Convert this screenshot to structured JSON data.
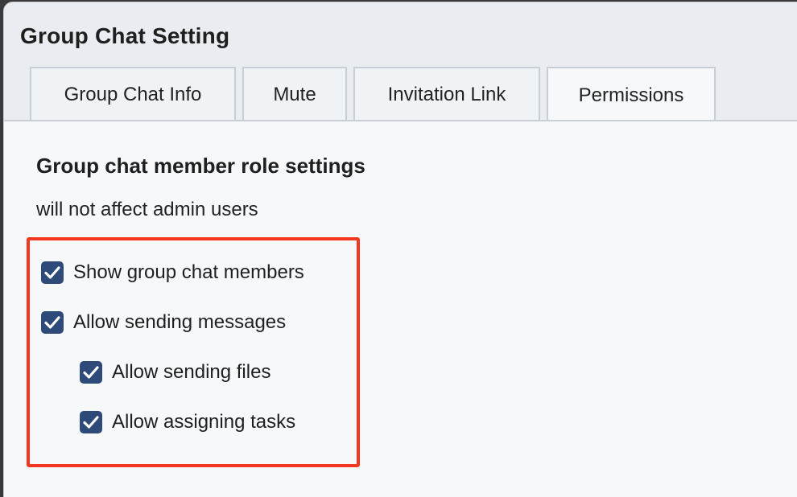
{
  "dialog": {
    "title": "Group Chat Setting"
  },
  "tabs": [
    {
      "label": "Group Chat Info"
    },
    {
      "label": "Mute"
    },
    {
      "label": "Invitation Link"
    },
    {
      "label": "Permissions",
      "active": true
    }
  ],
  "permissions": {
    "heading": "Group chat member role settings",
    "subtext": "will not affect admin users",
    "options": [
      {
        "label": "Show group chat members",
        "checked": true
      },
      {
        "label": "Allow sending messages",
        "checked": true
      },
      {
        "label": "Allow sending files",
        "checked": true
      },
      {
        "label": "Allow assigning tasks",
        "checked": true
      }
    ]
  },
  "colors": {
    "checkbox": "#2d4a78",
    "highlight": "#f2361f",
    "background": "#f6f8fa"
  }
}
